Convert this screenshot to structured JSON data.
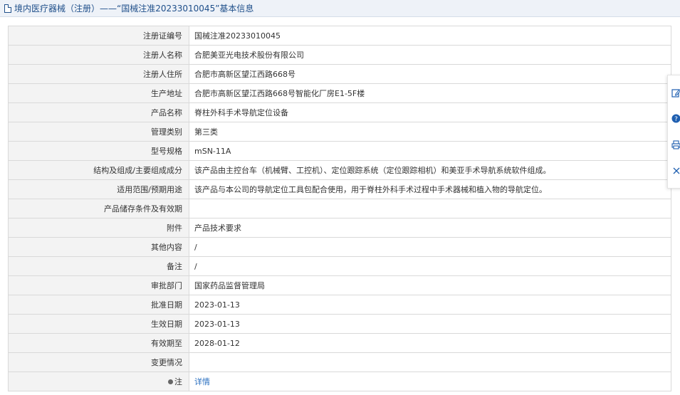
{
  "header": {
    "title": "境内医疗器械（注册）——“国械注准20233010045”基本信息",
    "icon": "document-icon"
  },
  "rows": [
    {
      "label": "注册证编号",
      "value": "国械注准20233010045"
    },
    {
      "label": "注册人名称",
      "value": "合肥美亚光电技术股份有限公司"
    },
    {
      "label": "注册人住所",
      "value": "合肥市高新区望江西路668号"
    },
    {
      "label": "生产地址",
      "value": "合肥市高新区望江西路668号智能化厂房E1-5F楼"
    },
    {
      "label": "产品名称",
      "value": "脊柱外科手术导航定位设备"
    },
    {
      "label": "管理类别",
      "value": "第三类"
    },
    {
      "label": "型号规格",
      "value": "mSN-11A"
    },
    {
      "label": "结构及组成/主要组成成分",
      "value": "该产品由主控台车（机械臂、工控机）、定位跟踪系统（定位跟踪相机）和美亚手术导航系统软件组成。"
    },
    {
      "label": "适用范围/预期用途",
      "value": "该产品与本公司的导航定位工具包配合使用，用于脊柱外科手术过程中手术器械和植入物的导航定位。"
    },
    {
      "label": "产品储存条件及有效期",
      "value": ""
    },
    {
      "label": "附件",
      "value": "产品技术要求"
    },
    {
      "label": "其他内容",
      "value": "/"
    },
    {
      "label": "备注",
      "value": "/"
    },
    {
      "label": "审批部门",
      "value": "国家药品监督管理局"
    },
    {
      "label": "批准日期",
      "value": "2023-01-13"
    },
    {
      "label": "生效日期",
      "value": "2023-01-13"
    },
    {
      "label": "有效期至",
      "value": "2028-01-12"
    },
    {
      "label": "变更情况",
      "value": ""
    }
  ],
  "note_row": {
    "label": "注",
    "link": "详情",
    "icon": "pin-icon"
  },
  "side_toolbar": [
    "edit-icon",
    "help-icon",
    "print-icon",
    "close-icon"
  ],
  "colors": {
    "title": "#1f4f8a",
    "link": "#2a6fc0",
    "label_bg": "#f3f3f3",
    "border": "#d9d9d9",
    "help": "#1f5fb0"
  }
}
